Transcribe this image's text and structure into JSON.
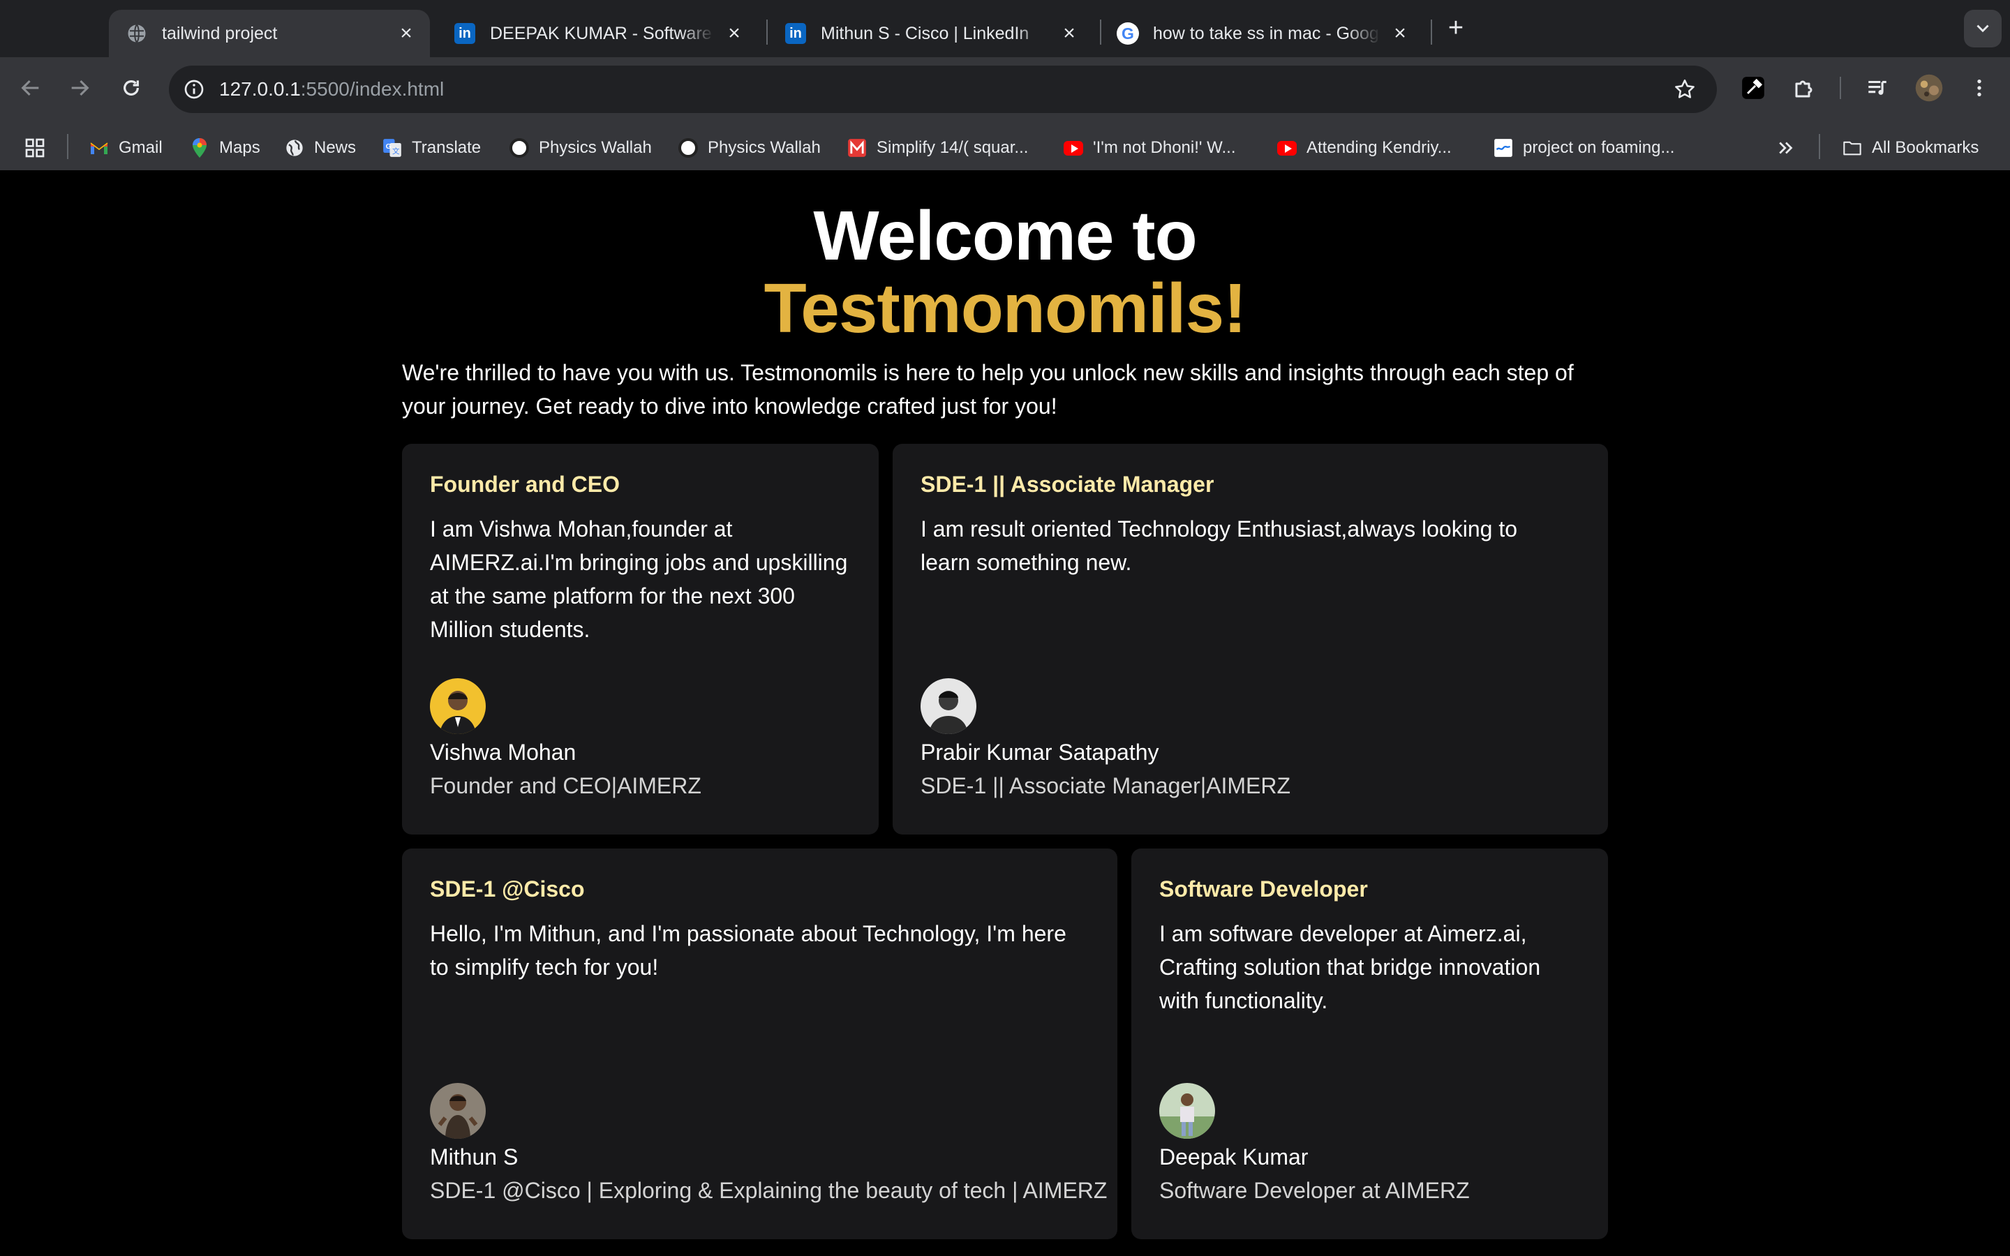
{
  "browser": {
    "tabs": [
      {
        "title": "tailwind project",
        "favicon": "globe-icon",
        "active": true
      },
      {
        "title": "DEEPAK KUMAR - Software Developer",
        "favicon": "linkedin-icon",
        "active": false
      },
      {
        "title": "Mithun S - Cisco | LinkedIn",
        "favicon": "linkedin-icon",
        "active": false
      },
      {
        "title": "how to take ss in mac - Google Search",
        "favicon": "google-icon",
        "active": false
      }
    ],
    "new_tab": "+",
    "address": {
      "host": "127.0.0.1",
      "path": ":5500/index.html"
    },
    "bookmarks": [
      {
        "label": "Gmail",
        "icon": "gmail-icon"
      },
      {
        "label": "Maps",
        "icon": "maps-icon"
      },
      {
        "label": "News",
        "icon": "globe-icon"
      },
      {
        "label": "Translate",
        "icon": "translate-icon"
      },
      {
        "label": "Physics Wallah",
        "icon": "physics-wallah-icon"
      },
      {
        "label": "Physics Wallah",
        "icon": "physics-wallah-icon"
      },
      {
        "label": "Simplify 14/( squar...",
        "icon": "simplify-icon"
      },
      {
        "label": "'I'm not Dhoni!' W...",
        "icon": "youtube-icon"
      },
      {
        "label": "Attending Kendriy...",
        "icon": "youtube-icon"
      },
      {
        "label": "project on foaming...",
        "icon": "doc-icon"
      }
    ],
    "all_bookmarks": "All Bookmarks",
    "colors": {
      "frame": "#202124",
      "toolbar": "#35363a",
      "text": "#e8eaed"
    }
  },
  "hero": {
    "line1": "Welcome to",
    "line2": "Testmonomils!",
    "intro": "We're thrilled to have you with us. Testmonomils is here to help you unlock new skills and insights through each step of your journey. Get ready to dive into knowledge crafted just for you!"
  },
  "testimonials": [
    {
      "role": "Founder and CEO",
      "quote": "I am Vishwa Mohan,founder at AIMERZ.ai.I'm bringing jobs and upskilling at the same platform for the next 300 Million students.",
      "name": "Vishwa Mohan",
      "subtitle": "Founder and CEO|AIMERZ"
    },
    {
      "role": "SDE-1 || Associate Manager",
      "quote": "I am result oriented Technology Enthusiast,always looking to learn something new.",
      "name": "Prabir Kumar Satapathy",
      "subtitle": "SDE-1 || Associate Manager|AIMERZ"
    },
    {
      "role": "SDE-1 @Cisco",
      "quote": "Hello, I'm Mithun, and I'm passionate about Technology, I'm here to simplify tech for you!",
      "name": "Mithun S",
      "subtitle": "SDE-1 @Cisco | Exploring & Explaining the beauty of tech | AIMERZ"
    },
    {
      "role": "Software Developer",
      "quote": "I am software developer at Aimerz.ai, Crafting solution that bridge innovation with functionality.",
      "name": "Deepak Kumar",
      "subtitle": "Software Developer at AIMERZ"
    }
  ],
  "colors": {
    "accent": "#e3b341",
    "role": "#fdeaa9",
    "card": "#18181a",
    "background": "#000000"
  }
}
